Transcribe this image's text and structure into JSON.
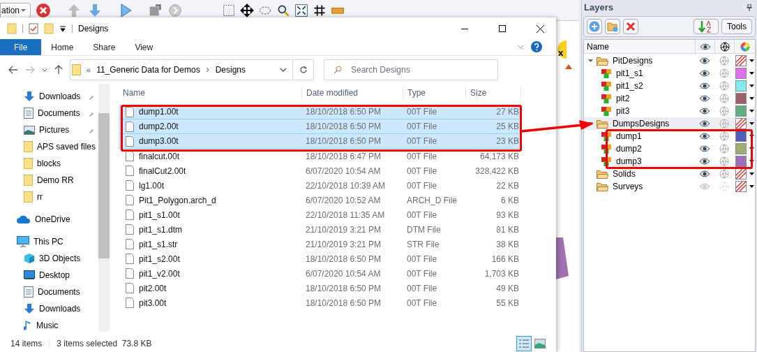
{
  "app_toolbar": {
    "dropdown_text": "ation"
  },
  "explorer": {
    "title": "Designs",
    "ribbon_tabs": [
      {
        "label": "File",
        "selected": true
      },
      {
        "label": "Home",
        "selected": false
      },
      {
        "label": "Share",
        "selected": false
      },
      {
        "label": "View",
        "selected": false
      }
    ],
    "breadcrumb": {
      "overflow": "«",
      "parts": [
        "11_Generic Data for Demos",
        "Designs"
      ]
    },
    "search": {
      "placeholder": "Search Designs"
    },
    "nav": [
      {
        "label": "Downloads",
        "kind": "download",
        "pinned": true
      },
      {
        "label": "Documents",
        "kind": "document",
        "pinned": true
      },
      {
        "label": "Pictures",
        "kind": "picture",
        "pinned": true
      },
      {
        "label": "APS saved files",
        "kind": "folder",
        "pinned": false
      },
      {
        "label": "blocks",
        "kind": "folder",
        "pinned": false
      },
      {
        "label": "Demo RR",
        "kind": "folder",
        "pinned": false
      },
      {
        "label": "rr",
        "kind": "folder",
        "pinned": false
      },
      {
        "label": "OneDrive",
        "kind": "onedrive",
        "pinned": false
      },
      {
        "label": "This PC",
        "kind": "pc",
        "pinned": false,
        "children": [
          {
            "label": "3D Objects",
            "kind": "objects3d",
            "pinned": false
          },
          {
            "label": "Desktop",
            "kind": "desktop",
            "pinned": false
          },
          {
            "label": "Documents",
            "kind": "document",
            "pinned": false
          },
          {
            "label": "Downloads",
            "kind": "download",
            "pinned": false
          },
          {
            "label": "Music",
            "kind": "music",
            "pinned": false
          }
        ]
      }
    ],
    "columns": [
      "Name",
      "Date modified",
      "Type",
      "Size"
    ],
    "rows": [
      {
        "name": "dump1.00t",
        "date": "18/10/2018 6:50 PM",
        "type": "00T File",
        "size": "27 KB",
        "selected": true
      },
      {
        "name": "dump2.00t",
        "date": "18/10/2018 6:50 PM",
        "type": "00T File",
        "size": "25 KB",
        "selected": true
      },
      {
        "name": "dump3.00t",
        "date": "18/10/2018 6:50 PM",
        "type": "00T File",
        "size": "23 KB",
        "selected": true
      },
      {
        "name": "finalcut.00t",
        "date": "18/10/2018 6:47 PM",
        "type": "00T File",
        "size": "64,173 KB",
        "selected": false
      },
      {
        "name": "finalCut2.00t",
        "date": "6/07/2020 10:54 AM",
        "type": "00T File",
        "size": "328,422 KB",
        "selected": false
      },
      {
        "name": "lg1.00t",
        "date": "22/10/2018 10:39 AM",
        "type": "00T File",
        "size": "22 KB",
        "selected": false
      },
      {
        "name": "Pit1_Polygon.arch_d",
        "date": "6/07/2020 10:52 AM",
        "type": "ARCH_D File",
        "size": "6 KB",
        "selected": false
      },
      {
        "name": "pit1_s1.00t",
        "date": "22/10/2018 11:35 AM",
        "type": "00T File",
        "size": "93 KB",
        "selected": false
      },
      {
        "name": "pit1_s1.dtm",
        "date": "21/10/2019 3:21 PM",
        "type": "DTM File",
        "size": "81 KB",
        "selected": false
      },
      {
        "name": "pit1_s1.str",
        "date": "21/10/2019 3:21 PM",
        "type": "STR File",
        "size": "38 KB",
        "selected": false
      },
      {
        "name": "pit1_s2.00t",
        "date": "18/10/2018 6:50 PM",
        "type": "00T File",
        "size": "166 KB",
        "selected": false
      },
      {
        "name": "pit1_v2.00t",
        "date": "6/07/2020 10:54 AM",
        "type": "00T File",
        "size": "1,703 KB",
        "selected": false
      },
      {
        "name": "pit2.00t",
        "date": "18/10/2018 6:50 PM",
        "type": "00T File",
        "size": "49 KB",
        "selected": false
      },
      {
        "name": "pit3.00t",
        "date": "18/10/2018 6:50 PM",
        "type": "00T File",
        "size": "55 KB",
        "selected": false
      }
    ],
    "status": {
      "count": "14 items",
      "selection": "3 items selected  73.8 KB"
    }
  },
  "canvas": {
    "label": "x"
  },
  "layers": {
    "title": "Layers",
    "tools_button": "Tools",
    "header": "Name",
    "tree": [
      {
        "name": "PitDesigns",
        "kind": "folder",
        "visible": true,
        "expanded": true,
        "selected": false,
        "children": [
          {
            "name": "pit1_s1",
            "kind": "layer",
            "visible": true,
            "color": "#e070f0"
          },
          {
            "name": "pit1_s2",
            "kind": "layer",
            "visible": true,
            "color": "#80eef0"
          },
          {
            "name": "pit2",
            "kind": "layer",
            "visible": true,
            "color": "#a06070"
          },
          {
            "name": "pit3",
            "kind": "layer",
            "visible": true,
            "color": "#60b080"
          }
        ]
      },
      {
        "name": "DumpsDesigns",
        "kind": "folder",
        "visible": true,
        "expanded": true,
        "selected": true,
        "children": [
          {
            "name": "dump1",
            "kind": "layer",
            "visible": true,
            "color": "#5060c0"
          },
          {
            "name": "dump2",
            "kind": "layer",
            "visible": true,
            "color": "#a0b070"
          },
          {
            "name": "dump3",
            "kind": "layer",
            "visible": true,
            "color": "#a070c0"
          }
        ]
      },
      {
        "name": "Solids",
        "kind": "folder",
        "visible": true,
        "expanded": false,
        "selected": false
      },
      {
        "name": "Surveys",
        "kind": "folder",
        "visible": false,
        "expanded": false,
        "selected": false
      }
    ]
  }
}
